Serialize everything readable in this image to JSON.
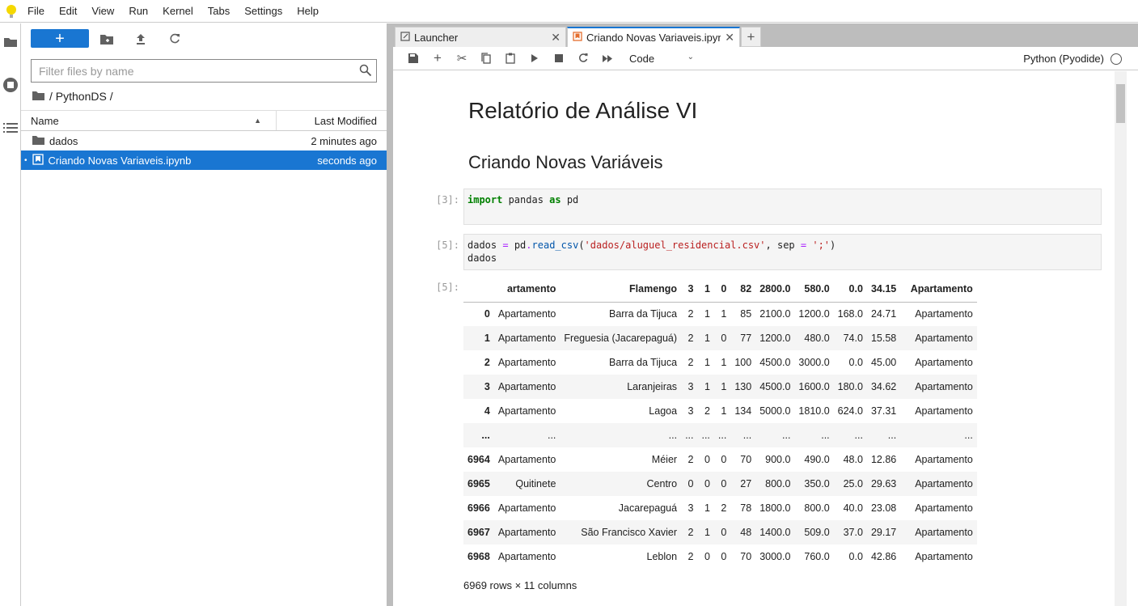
{
  "menubar": {
    "items": [
      "File",
      "Edit",
      "View",
      "Run",
      "Kernel",
      "Tabs",
      "Settings",
      "Help"
    ]
  },
  "filebrowser": {
    "new_label": "+",
    "filter_placeholder": "Filter files by name",
    "breadcrumb": "/ PythonDS /",
    "columns": {
      "name": "Name",
      "modified": "Last Modified"
    },
    "files": [
      {
        "name": "dados",
        "modified": "2 minutes ago",
        "type": "folder"
      },
      {
        "name": "Criando Novas Variaveis.ipynb",
        "modified": "seconds ago",
        "type": "notebook",
        "selected": true
      }
    ]
  },
  "tabs": [
    {
      "label": "Launcher"
    },
    {
      "label": "Criando Novas Variaveis.ipyn"
    }
  ],
  "toolbar": {
    "cell_type": "Code",
    "kernel": "Python (Pyodide)"
  },
  "notebook": {
    "h1": "Relatório de Análise VI",
    "h2": "Criando Novas Variáveis",
    "cells": [
      {
        "prompt": "[3]:"
      },
      {
        "prompt": "[5]:"
      }
    ],
    "output_prompt": "[5]:",
    "table": {
      "columns": [
        "",
        "artamento",
        "Flamengo",
        "3",
        "1",
        "0",
        "82",
        "2800.0",
        "580.0",
        "0.0",
        "34.15",
        "Apartamento"
      ],
      "rows": [
        [
          "0",
          "Apartamento",
          "Barra da Tijuca",
          "2",
          "1",
          "1",
          "85",
          "2100.0",
          "1200.0",
          "168.0",
          "24.71",
          "Apartamento"
        ],
        [
          "1",
          "Apartamento",
          "Freguesia (Jacarepaguá)",
          "2",
          "1",
          "0",
          "77",
          "1200.0",
          "480.0",
          "74.0",
          "15.58",
          "Apartamento"
        ],
        [
          "2",
          "Apartamento",
          "Barra da Tijuca",
          "2",
          "1",
          "1",
          "100",
          "4500.0",
          "3000.0",
          "0.0",
          "45.00",
          "Apartamento"
        ],
        [
          "3",
          "Apartamento",
          "Laranjeiras",
          "3",
          "1",
          "1",
          "130",
          "4500.0",
          "1600.0",
          "180.0",
          "34.62",
          "Apartamento"
        ],
        [
          "4",
          "Apartamento",
          "Lagoa",
          "3",
          "2",
          "1",
          "134",
          "5000.0",
          "1810.0",
          "624.0",
          "37.31",
          "Apartamento"
        ],
        [
          "...",
          "...",
          "...",
          "...",
          "...",
          "...",
          "...",
          "...",
          "...",
          "...",
          "...",
          "..."
        ],
        [
          "6964",
          "Apartamento",
          "Méier",
          "2",
          "0",
          "0",
          "70",
          "900.0",
          "490.0",
          "48.0",
          "12.86",
          "Apartamento"
        ],
        [
          "6965",
          "Quitinete",
          "Centro",
          "0",
          "0",
          "0",
          "27",
          "800.0",
          "350.0",
          "25.0",
          "29.63",
          "Apartamento"
        ],
        [
          "6966",
          "Apartamento",
          "Jacarepaguá",
          "3",
          "1",
          "2",
          "78",
          "1800.0",
          "800.0",
          "40.0",
          "23.08",
          "Apartamento"
        ],
        [
          "6967",
          "Apartamento",
          "São Francisco Xavier",
          "2",
          "1",
          "0",
          "48",
          "1400.0",
          "509.0",
          "37.0",
          "29.17",
          "Apartamento"
        ],
        [
          "6968",
          "Apartamento",
          "Leblon",
          "2",
          "0",
          "0",
          "70",
          "3000.0",
          "760.0",
          "0.0",
          "42.86",
          "Apartamento"
        ]
      ]
    },
    "shape": "6969 rows × 11 columns"
  },
  "colors": {
    "accent": "#1976d2"
  }
}
